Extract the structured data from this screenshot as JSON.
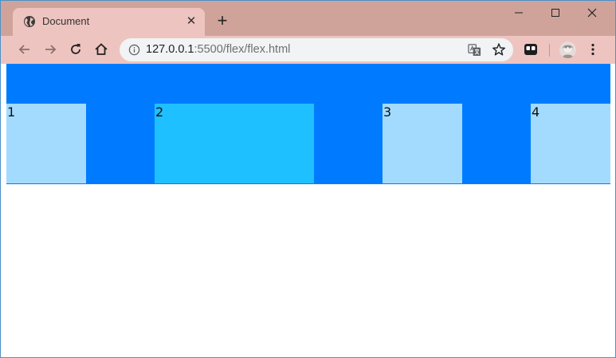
{
  "browser": {
    "tab": {
      "title": "Document",
      "favicon": "globe-icon",
      "close": "✕"
    },
    "new_tab": "+",
    "window_controls": {
      "minimize": "—",
      "maximize": "☐",
      "close": "✕"
    },
    "url": {
      "host": "127.0.0.1",
      "path": ":5500/flex/flex.html"
    },
    "nav_icons": [
      "back-icon",
      "forward-icon",
      "reload-icon",
      "home-icon"
    ],
    "toolbar_icons": [
      "info-icon",
      "translate-icon",
      "star-icon",
      "extension-icon",
      "avatar",
      "menu-icon"
    ]
  },
  "page": {
    "container_color": "#007bff",
    "items": [
      {
        "label": "1",
        "color": "#a3dbff"
      },
      {
        "label": "2",
        "color": "#1fc0ff"
      },
      {
        "label": "3",
        "color": "#a3dbff"
      },
      {
        "label": "4",
        "color": "#a3dbff"
      }
    ]
  }
}
